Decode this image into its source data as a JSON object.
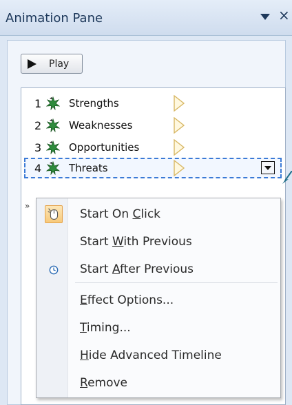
{
  "header": {
    "title": "Animation Pane",
    "dropdown_icon": "chevron-down-icon",
    "close_glyph": "×"
  },
  "toolbar": {
    "play_label": "Play",
    "play_icon": "play-icon"
  },
  "animation_list": {
    "items": [
      {
        "number": "1",
        "label": "Strengths",
        "icon": "star-effect-icon",
        "timing_icon": "timing-bar-icon",
        "selected": false
      },
      {
        "number": "2",
        "label": "Weaknesses",
        "icon": "star-effect-icon",
        "timing_icon": "timing-bar-icon",
        "selected": false
      },
      {
        "number": "3",
        "label": "Opportunities",
        "icon": "star-effect-icon",
        "timing_icon": "timing-bar-icon",
        "selected": false
      },
      {
        "number": "4",
        "label": "Threats",
        "icon": "star-effect-icon",
        "timing_icon": "timing-bar-icon",
        "selected": true
      }
    ],
    "collapse_glyph": "»"
  },
  "context_menu": {
    "items": [
      {
        "pre": "Start On ",
        "key": "C",
        "post": "lick",
        "icon": "mouse-click-icon",
        "checked": true
      },
      {
        "pre": "Start ",
        "key": "W",
        "post": "ith Previous",
        "icon": "",
        "checked": false
      },
      {
        "pre": "Start ",
        "key": "A",
        "post": "fter Previous",
        "icon": "clock-icon",
        "checked": false
      },
      {
        "pre": "",
        "key": "E",
        "post": "ffect Options...",
        "icon": "",
        "checked": false
      },
      {
        "pre": "",
        "key": "T",
        "post": "iming...",
        "icon": "",
        "checked": false
      },
      {
        "pre": "",
        "key": "H",
        "post": "ide Advanced Timeline",
        "icon": "",
        "checked": false
      },
      {
        "pre": "",
        "key": "R",
        "post": "emove",
        "icon": "",
        "checked": false
      }
    ]
  },
  "colors": {
    "star_green": "#2e8b3c",
    "selection_border": "#3b7ad6",
    "checked_highlight": "#f7c97a",
    "callout_arrow": "#1f6f8b"
  }
}
